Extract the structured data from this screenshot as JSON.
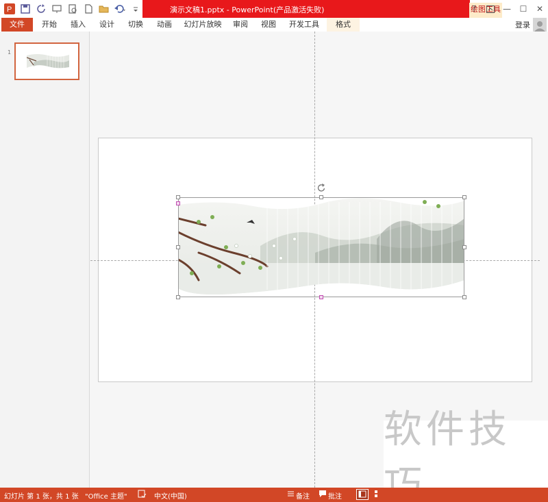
{
  "titlebar": {
    "document_title": "演示文稿1.pptx - PowerPoint(产品激活失败)",
    "context_tool": "绘图工具",
    "help": "?",
    "restore_icon_label": "⊡",
    "minimize": "—",
    "maximize": "☐",
    "close": "✕"
  },
  "tabs": {
    "file": "文件",
    "home": "开始",
    "insert": "插入",
    "design": "设计",
    "transitions": "切换",
    "animations": "动画",
    "slideshow": "幻灯片放映",
    "review": "审阅",
    "view": "视图",
    "developer": "开发工具",
    "format": "格式"
  },
  "account": {
    "login": "登录"
  },
  "thumbnails": [
    {
      "number": "1"
    }
  ],
  "watermark": {
    "text": "软件技巧"
  },
  "status": {
    "slide_info": "幻灯片 第 1 张，共 1 张",
    "theme": "\"Office 主题\"",
    "language": "中文(中国)",
    "notes": "备注",
    "comments": "批注"
  },
  "colors": {
    "accent": "#d24726",
    "title_red": "#e8181b",
    "context_tab": "#fdebc9"
  }
}
